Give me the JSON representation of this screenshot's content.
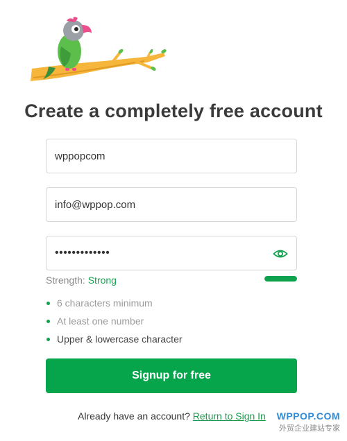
{
  "page": {
    "title": "Create a completely free account"
  },
  "form": {
    "username_value": "wppopcom",
    "email_value": "info@wppop.com",
    "password_value": "wppopcomwppop"
  },
  "strength": {
    "label": "Strength:",
    "value": "Strong",
    "level": 1.0,
    "color": "#0ea24f"
  },
  "rules": [
    {
      "text": "6 characters minimum"
    },
    {
      "text": "At least one number"
    },
    {
      "text": "Upper & lowercase character"
    }
  ],
  "actions": {
    "submit_label": "Signup for free"
  },
  "footer": {
    "prompt": "Already have an account?",
    "link": "Return to Sign In"
  },
  "watermark": {
    "brand": "WPPOP.COM",
    "subtitle": "外贸企业建站专家"
  },
  "colors": {
    "accent": "#06a54c",
    "title": "#3a3a3a"
  },
  "icons": {
    "logo": "parrot-on-branch-logo",
    "password_toggle": "eye-icon"
  }
}
